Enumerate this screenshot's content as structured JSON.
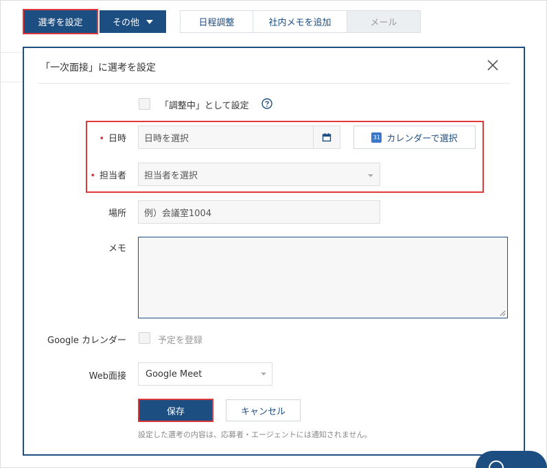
{
  "toolbar": {
    "select_label": "選考を設定",
    "other_label": "その他",
    "tabs": [
      "日程調整",
      "社内メモを追加",
      "メール"
    ]
  },
  "modal": {
    "title": "「一次面接」に選考を設定",
    "adjusting_label": "「調整中」として設定",
    "datetime": {
      "required_mark": "•",
      "label": "日時",
      "placeholder": "日時を選択",
      "calendar_icon_text": "31",
      "calendar_button": "カレンダーで選択"
    },
    "assignee": {
      "required_mark": "•",
      "label": "担当者",
      "placeholder": "担当者を選択"
    },
    "location": {
      "label": "場所",
      "placeholder": "例）会議室1004"
    },
    "memo": {
      "label": "メモ",
      "value": ""
    },
    "google_calendar": {
      "label": "Google カレンダー",
      "checkbox_label": "予定を登録"
    },
    "web_interview": {
      "label": "Web面接",
      "value": "Google Meet"
    },
    "save_label": "保存",
    "cancel_label": "キャンセル",
    "note": "設定した選考の内容は、応募者・エージェントには通知されません。"
  },
  "colors": {
    "primary": "#1d4e82",
    "highlight": "#e0373b",
    "required": "#d0343a"
  }
}
